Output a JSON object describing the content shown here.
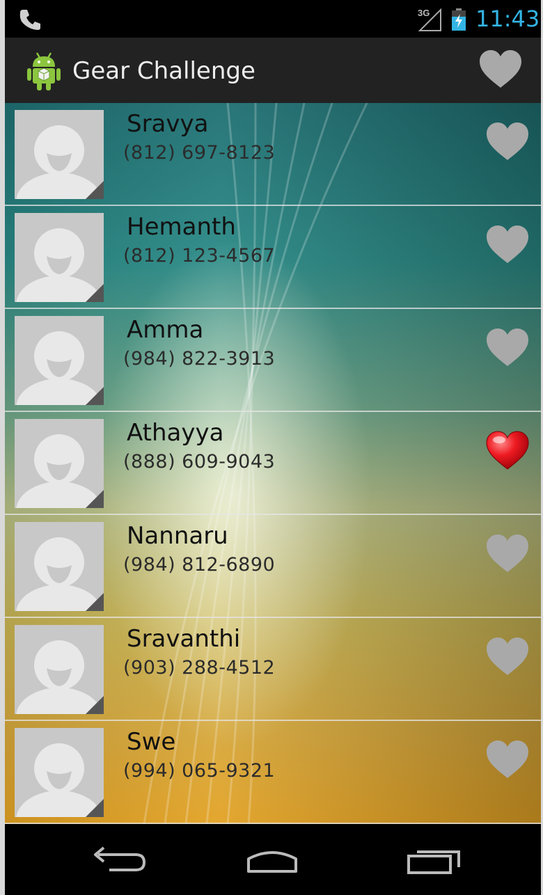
{
  "status_bar": {
    "network": "3G",
    "time": "11:43",
    "phone_icon": "phone-handset-icon",
    "battery_icon": "battery-charging-icon",
    "signal_icon": "signal-icon"
  },
  "action_bar": {
    "title": "Gear Challenge",
    "app_icon": "android-icon",
    "favorite_icon": "heart-icon"
  },
  "contacts": [
    {
      "name": "Sravya",
      "phone": "(812) 697-8123",
      "favorite": false
    },
    {
      "name": "Hemanth",
      "phone": "(812) 123-4567",
      "favorite": false
    },
    {
      "name": "Amma",
      "phone": "(984) 822-3913",
      "favorite": false
    },
    {
      "name": "Athayya",
      "phone": "(888) 609-9043",
      "favorite": true
    },
    {
      "name": "Nannaru",
      "phone": "(984) 812-6890",
      "favorite": false
    },
    {
      "name": "Sravanthi",
      "phone": "(903) 288-4512",
      "favorite": false
    },
    {
      "name": "Swe",
      "phone": "(994) 065-9321",
      "favorite": false
    }
  ],
  "nav_bar": {
    "back_icon": "back-arrow-icon",
    "home_icon": "home-icon",
    "recents_icon": "recent-apps-icon"
  },
  "colors": {
    "accent": "#33b5e5",
    "heart_inactive": "#a9a9a9",
    "heart_active": "#e8131a",
    "action_bar_bg": "#222222"
  }
}
